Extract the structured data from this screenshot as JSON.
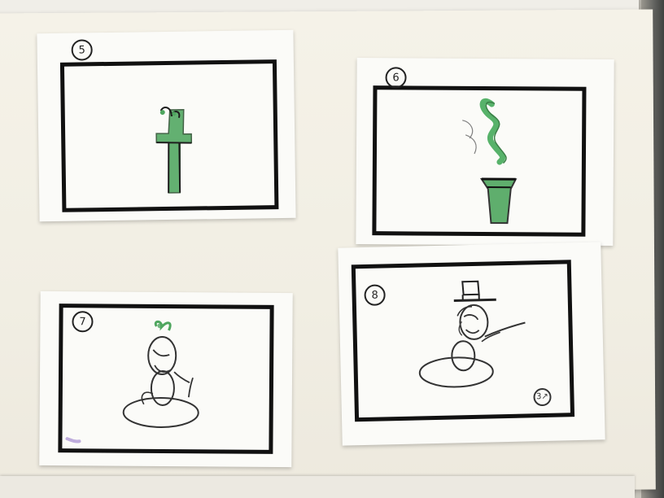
{
  "panels": [
    {
      "number": "5"
    },
    {
      "number": "6"
    },
    {
      "number": "7"
    },
    {
      "number": "8"
    }
  ],
  "corner_mark": "3↗",
  "colors": {
    "board": "#f3f0e6",
    "card": "#fbfbf8",
    "frame": "#111111",
    "green": "#4fa65f",
    "graphite": "#333333"
  }
}
